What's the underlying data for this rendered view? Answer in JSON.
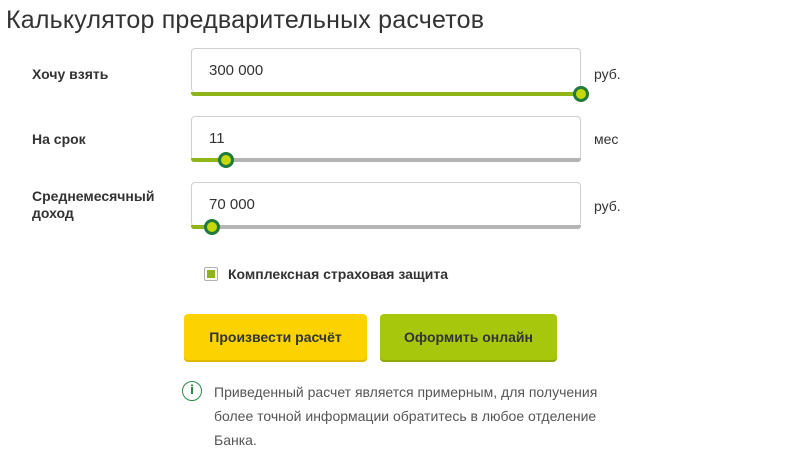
{
  "title": "Калькулятор предварительных расчетов",
  "fields": {
    "amount": {
      "label": "Хочу взять",
      "value": "300 000",
      "unit": "руб.",
      "slider_fraction": 1.0
    },
    "term": {
      "label": "На срок",
      "value": "11",
      "unit": "мес",
      "slider_fraction": 0.09
    },
    "income": {
      "label_line1": "Среднемесячный",
      "label_line2": "доход",
      "value": "70 000",
      "unit": "руб.",
      "slider_fraction": 0.055
    }
  },
  "insurance": {
    "label": "Комплексная страховая защита",
    "checked": true
  },
  "buttons": {
    "calculate": "Произвести расчёт",
    "apply_online": "Оформить онлайн"
  },
  "info": {
    "icon_glyph": "i",
    "line1": "Приведенный расчет является примерным, для получения",
    "line2": "более точной информации обратитесь в любое отделение",
    "line3": "Банка."
  },
  "colors": {
    "accent_green": "#8fb519",
    "thumb_border": "#1f7a3c",
    "button_yellow": "#fcd200",
    "button_green": "#a7c70c"
  }
}
